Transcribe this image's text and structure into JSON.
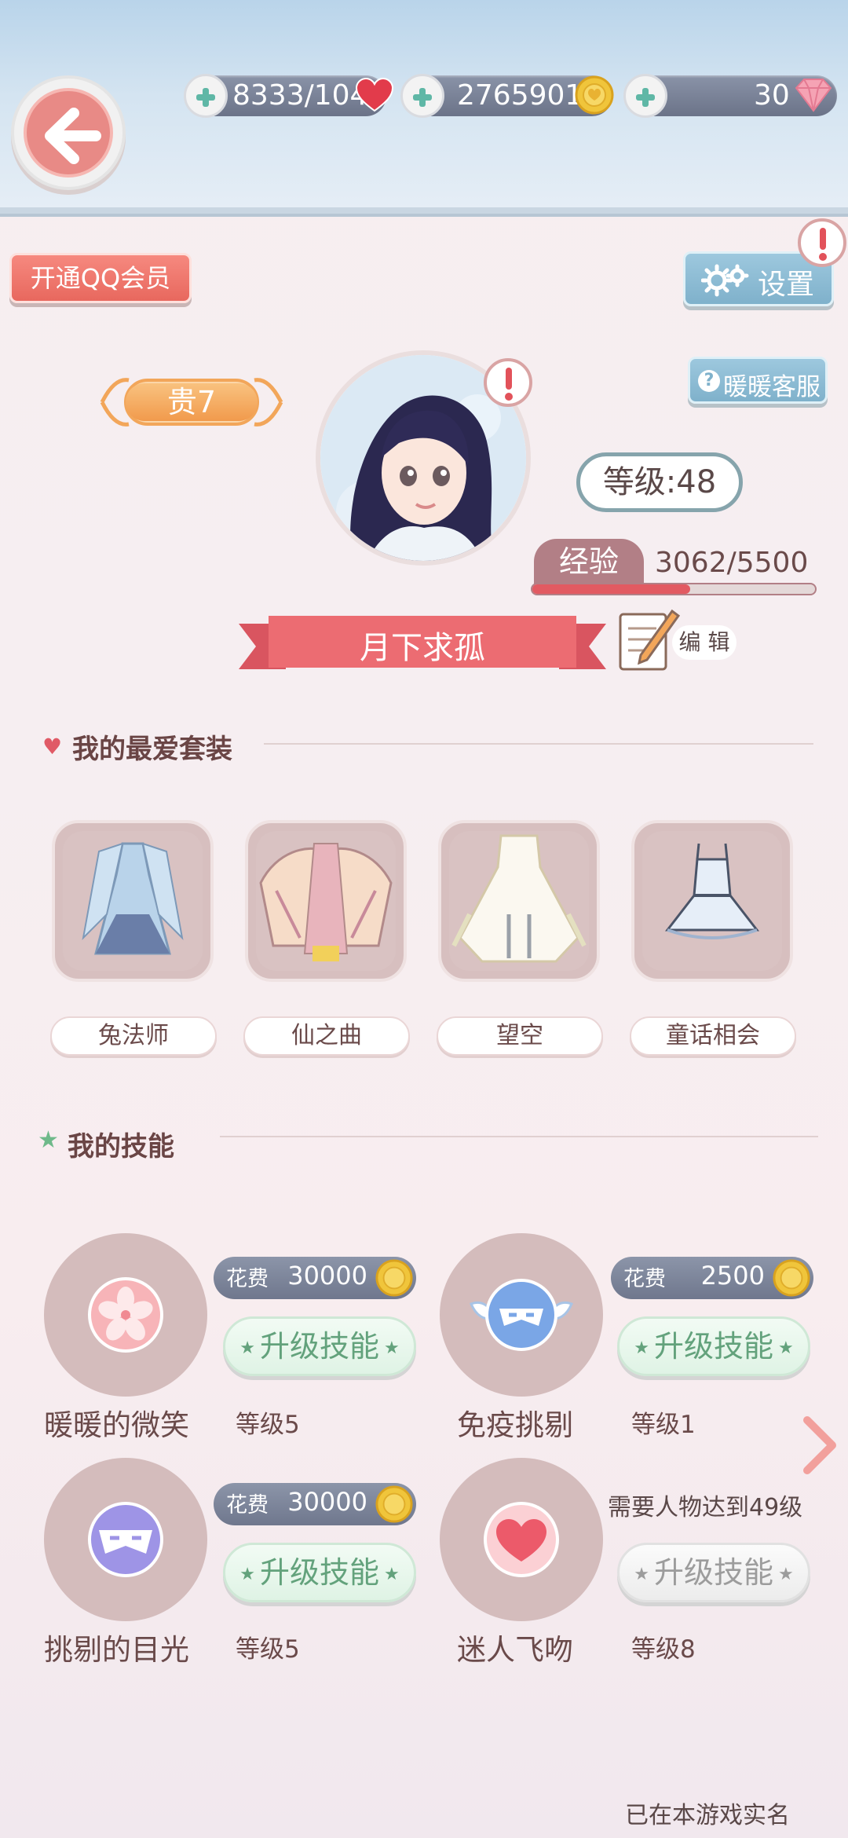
{
  "topbar": {
    "stamina": "8333/104",
    "coins": "2765901",
    "diamonds": "30",
    "colors": {
      "heart": "#e23b4b",
      "coin": "#f0c53b",
      "diamond": "#f08aa0"
    }
  },
  "header": {
    "qq_vip_button": "开通QQ会员",
    "settings_button": "设置",
    "customer_service_button": "暖暖客服"
  },
  "profile": {
    "noble_badge": "贵7",
    "level_label": "等级:48",
    "exp_label": "经验",
    "exp_value": "3062/5500",
    "exp_progress": 0.557,
    "nickname": "月下求孤",
    "edit_label": "编 辑"
  },
  "favorites": {
    "title": "我的最爱套装",
    "items": [
      {
        "name": "兔法师",
        "icon": "blue-gown-icon"
      },
      {
        "name": "仙之曲",
        "icon": "fairy-dress-icon"
      },
      {
        "name": "望空",
        "icon": "white-gown-icon"
      },
      {
        "name": "童话相会",
        "icon": "short-dress-icon"
      }
    ]
  },
  "skills": {
    "title": "我的技能",
    "cost_label": "花费",
    "upgrade_label": "升级技能",
    "items": [
      {
        "name": "暖暖的微笑",
        "level": "等级5",
        "cost": "30000",
        "icon": "sakura-orb-icon"
      },
      {
        "name": "免疫挑剔",
        "level": "等级1",
        "cost": "2500",
        "icon": "winged-mask-orb-icon"
      },
      {
        "name": "挑剔的目光",
        "level": "等级5",
        "cost": "30000",
        "icon": "mask-orb-icon"
      },
      {
        "name": "迷人飞吻",
        "level": "等级8",
        "requirement": "需要人物达到49级",
        "icon": "heart-orb-icon"
      }
    ]
  },
  "footer": {
    "realname_note": "已在本游戏实名"
  }
}
